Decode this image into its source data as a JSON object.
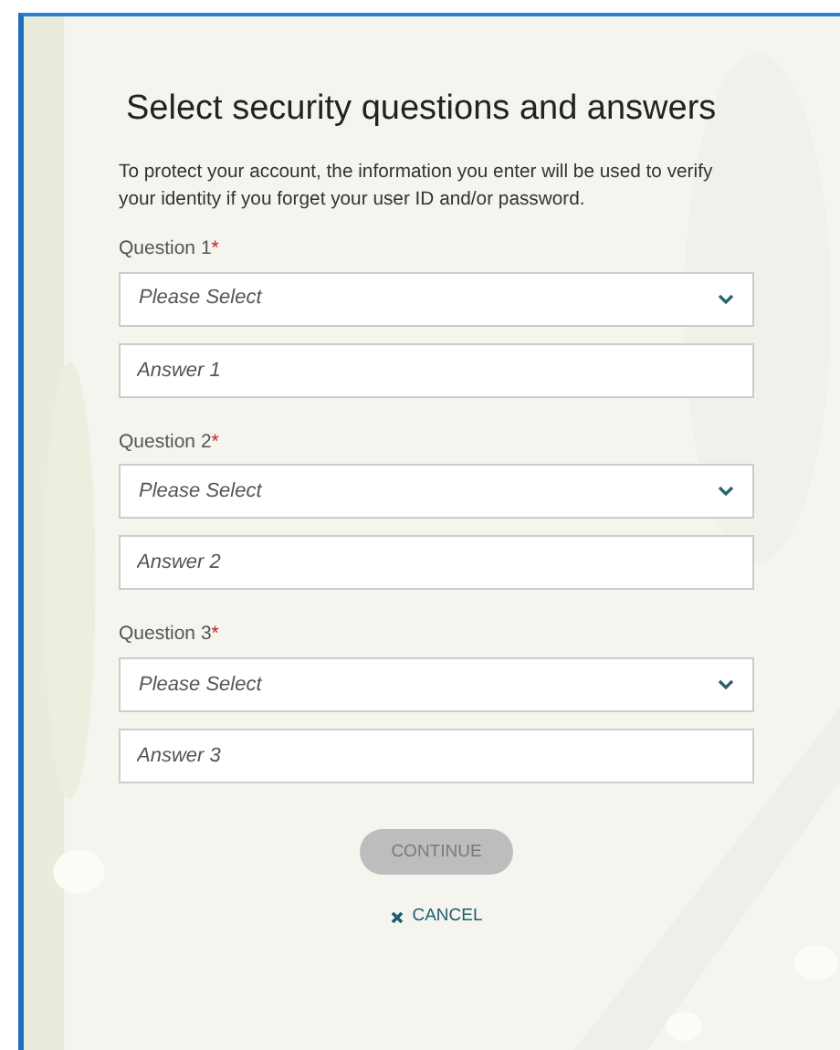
{
  "title": "Select security questions and answers",
  "intro": "To protect your account, the information you enter will be used to verify your identity if you forget your user ID and/or password.",
  "questions": [
    {
      "label": "Question 1",
      "required_mark": "*",
      "select_placeholder": "Please Select",
      "answer_placeholder": "Answer 1"
    },
    {
      "label": "Question 2",
      "required_mark": "*",
      "select_placeholder": "Please Select",
      "answer_placeholder": "Answer 2"
    },
    {
      "label": "Question 3",
      "required_mark": "*",
      "select_placeholder": "Please Select",
      "answer_placeholder": "Answer 3"
    }
  ],
  "continue_button": {
    "label": "CONTINUE",
    "disabled": true
  },
  "cancel_link": {
    "label": "CANCEL"
  }
}
